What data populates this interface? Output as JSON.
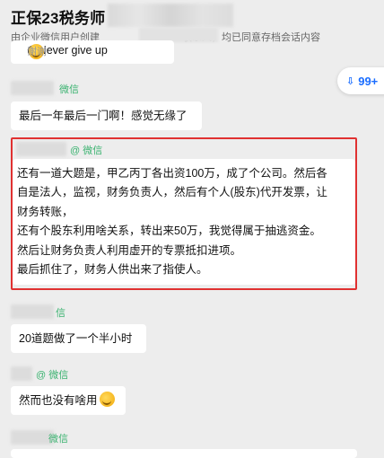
{
  "header": {
    "title": "正保23税务师",
    "subtitle": "由企业微信用户创建",
    "subtitle_tail": "联系人，均已同意存档会话内容"
  },
  "top_partial_message": "@Never give up",
  "unread_badge": {
    "arrow": "⇩",
    "count": "99+"
  },
  "messages": [
    {
      "sender": "微信",
      "text": "最后一年最后一门啊！感觉无缘了"
    },
    {
      "sender": "@ 微信",
      "lines": [
        "还有一道大题是，甲乙丙丁各出资100万，成了个公司。然后各",
        "自是法人，监视，财务负责人，然后有个人(股东)代开发票，让",
        "财务转账，",
        "还有个股东利用啥关系，转出来50万，我觉得属于抽逃资金。",
        "然后让财务负责人利用虚开的专票抵扣进项。",
        "最后抓住了，财务人供出来了指使人。"
      ]
    },
    {
      "sender": "信",
      "text": "20道题做了一个半小时"
    },
    {
      "sender": "@ 微信",
      "text": "然而也没有啥用"
    },
    {
      "sender": "微信"
    }
  ],
  "colors": {
    "background": "#ededed",
    "bubble": "#ffffff",
    "sender": "#3cb371",
    "highlight_border": "#e03131",
    "badge_text": "#1a6dff"
  }
}
